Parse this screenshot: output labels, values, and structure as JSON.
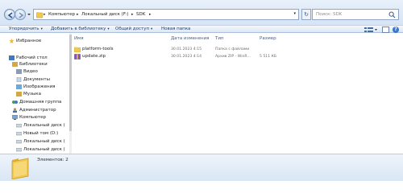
{
  "address": {
    "crumbs": [
      "Компьютер",
      "Локальный диск (F:)",
      "SDK"
    ],
    "search_placeholder": "Поиск: SDK"
  },
  "toolbar": {
    "organize": "Упорядочить",
    "add_to_library": "Добавить в библиотеку",
    "share": "Общий доступ",
    "new_folder": "Новая папка"
  },
  "nav": {
    "favorites": "Избранное",
    "desktop": "Рабочий стол",
    "libraries": "Библиотеки",
    "video": "Видео",
    "documents": "Документы",
    "images": "Изображения",
    "music": "Музыка",
    "homegroup": "Домашняя группа",
    "admin": "Администратор",
    "computer": "Компьютер",
    "drive_c": "Локальный диск (",
    "drive_d": "Новый том (D:)",
    "drive_e": "Локальный диск (",
    "drive_f": "Локальный диск ("
  },
  "columns": {
    "name": "Имя",
    "date": "Дата изменения",
    "type": "Тип",
    "size": "Размер"
  },
  "files": [
    {
      "name": "platform-tools",
      "date": "30.01.2023 4:15",
      "type": "Папка с файлами",
      "size": "",
      "icon": "folder-icon"
    },
    {
      "name": "update.zip",
      "date": "30.01.2023 4:14",
      "type": "Архив ZIP - WinR...",
      "size": "5 511 КБ",
      "icon": "zip-archive-icon"
    }
  ],
  "details": {
    "count": "Элементов: 2"
  },
  "colors": {
    "accent": "#3a76c9",
    "folder": "#f2c94c"
  }
}
